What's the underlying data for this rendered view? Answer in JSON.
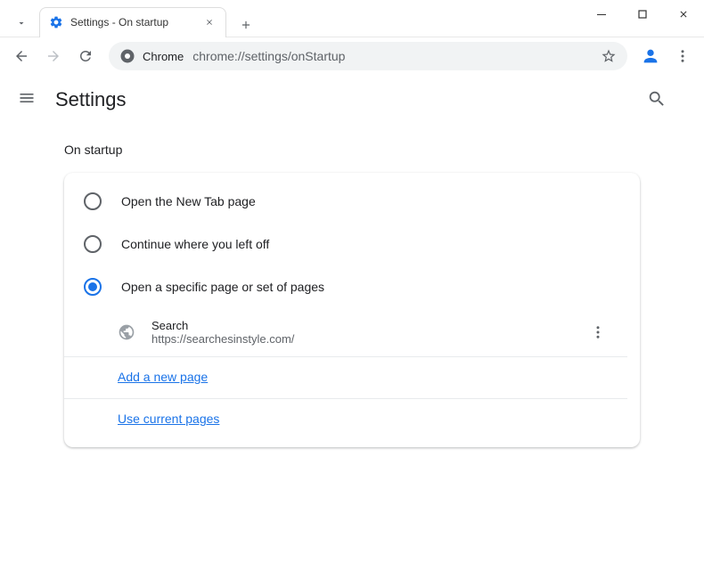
{
  "browser": {
    "tab_title": "Settings - On startup",
    "omnibox_chip": "Chrome",
    "url": "chrome://settings/onStartup"
  },
  "settings": {
    "header_title": "Settings",
    "section_title": "On startup",
    "options": [
      {
        "label": "Open the New Tab page",
        "selected": false
      },
      {
        "label": "Continue where you left off",
        "selected": false
      },
      {
        "label": "Open a specific page or set of pages",
        "selected": true
      }
    ],
    "page_entry": {
      "name": "Search",
      "url": "https://searchesinstyle.com/"
    },
    "links": {
      "add_new": "Add a new page",
      "use_current": "Use current pages"
    }
  }
}
